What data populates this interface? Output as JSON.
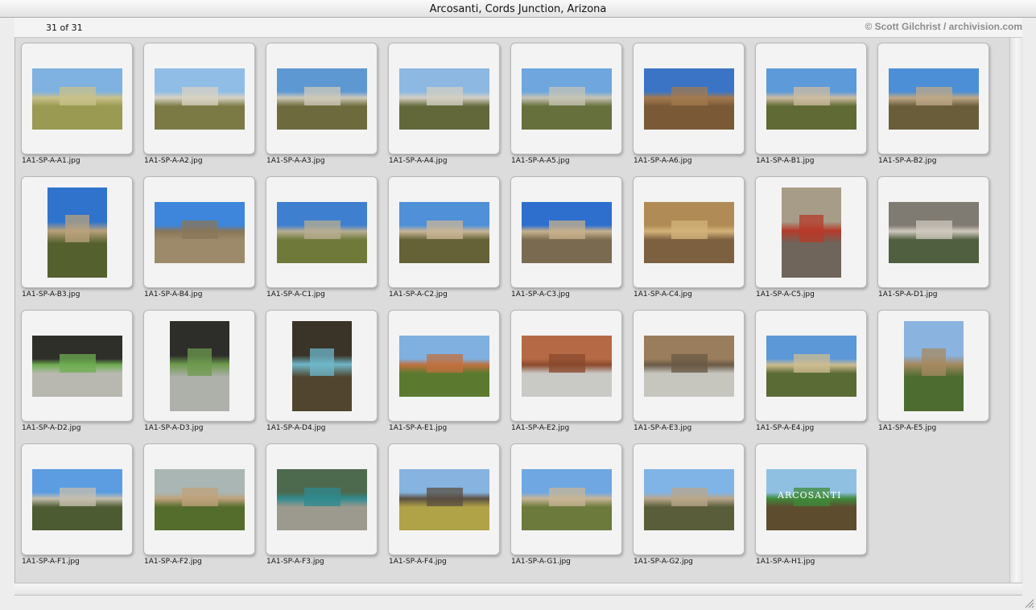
{
  "window": {
    "title": "Arcosanti, Cords Junction, Arizona"
  },
  "info": {
    "count": "31 of 31",
    "credit": "© Scott Gilchrist / archivision.com"
  },
  "items": [
    {
      "filename": "1A1-SP-A-A1.jpg",
      "orient": "landscape",
      "sky": "#7fb2e0",
      "ground": "#9a9a52",
      "accent": "#c9c18a"
    },
    {
      "filename": "1A1-SP-A-A2.jpg",
      "orient": "landscape",
      "sky": "#8fbde6",
      "ground": "#7b7a45",
      "accent": "#d8d2c2"
    },
    {
      "filename": "1A1-SP-A-A3.jpg",
      "orient": "landscape",
      "sky": "#5e98d2",
      "ground": "#6d6b3d",
      "accent": "#cfcab9"
    },
    {
      "filename": "1A1-SP-A-A4.jpg",
      "orient": "landscape",
      "sky": "#8cb8e2",
      "ground": "#62683a",
      "accent": "#d3cfc3"
    },
    {
      "filename": "1A1-SP-A-A5.jpg",
      "orient": "landscape",
      "sky": "#6ea6dd",
      "ground": "#66703c",
      "accent": "#c7c4b5"
    },
    {
      "filename": "1A1-SP-A-A6.jpg",
      "orient": "landscape",
      "sky": "#3b74c4",
      "ground": "#7a5a36",
      "accent": "#a37a4f"
    },
    {
      "filename": "1A1-SP-A-B1.jpg",
      "orient": "landscape",
      "sky": "#5d9ad9",
      "ground": "#5f6a34",
      "accent": "#cdbca0"
    },
    {
      "filename": "1A1-SP-A-B2.jpg",
      "orient": "landscape",
      "sky": "#4c8fd6",
      "ground": "#6a5d3a",
      "accent": "#bfa887"
    },
    {
      "filename": "1A1-SP-A-B3.jpg",
      "orient": "portrait",
      "sky": "#2f73cc",
      "ground": "#55602f",
      "accent": "#b9a17c"
    },
    {
      "filename": "1A1-SP-A-B4.jpg",
      "orient": "landscape",
      "sky": "#3d86db",
      "ground": "#9c8a6a",
      "accent": "#8a7658"
    },
    {
      "filename": "1A1-SP-A-C1.jpg",
      "orient": "landscape",
      "sky": "#3f7fd0",
      "ground": "#6f7a3a",
      "accent": "#b8ad92"
    },
    {
      "filename": "1A1-SP-A-C2.jpg",
      "orient": "landscape",
      "sky": "#4f90d8",
      "ground": "#646236",
      "accent": "#c9b597"
    },
    {
      "filename": "1A1-SP-A-C3.jpg",
      "orient": "landscape",
      "sky": "#2e6fcd",
      "ground": "#7a6b50",
      "accent": "#c7b08c"
    },
    {
      "filename": "1A1-SP-A-C4.jpg",
      "orient": "landscape",
      "sky": "#b08b55",
      "ground": "#7d6040",
      "accent": "#d3b37a"
    },
    {
      "filename": "1A1-SP-A-C5.jpg",
      "orient": "portrait",
      "sky": "#a79c88",
      "ground": "#6f655a",
      "accent": "#b53a2a"
    },
    {
      "filename": "1A1-SP-A-D1.jpg",
      "orient": "landscape",
      "sky": "#7f7a72",
      "ground": "#4f5f3f",
      "accent": "#cfc8bd"
    },
    {
      "filename": "1A1-SP-A-D2.jpg",
      "orient": "landscape",
      "sky": "#2f2f2a",
      "ground": "#b8b8b0",
      "accent": "#6fae52"
    },
    {
      "filename": "1A1-SP-A-D3.jpg",
      "orient": "portrait",
      "sky": "#2d2d2a",
      "ground": "#aeb0aa",
      "accent": "#6d9a4d"
    },
    {
      "filename": "1A1-SP-A-D4.jpg",
      "orient": "portrait",
      "sky": "#3a3328",
      "ground": "#51452f",
      "accent": "#6fb7c9"
    },
    {
      "filename": "1A1-SP-A-E1.jpg",
      "orient": "landscape",
      "sky": "#7fb0e0",
      "ground": "#5b7a2f",
      "accent": "#c0703e"
    },
    {
      "filename": "1A1-SP-A-E2.jpg",
      "orient": "landscape",
      "sky": "#b56a45",
      "ground": "#c9c9c6",
      "accent": "#8a4a2e"
    },
    {
      "filename": "1A1-SP-A-E3.jpg",
      "orient": "landscape",
      "sky": "#9a7d5c",
      "ground": "#c6c6bf",
      "accent": "#6a5a46"
    },
    {
      "filename": "1A1-SP-A-E4.jpg",
      "orient": "landscape",
      "sky": "#5c97d7",
      "ground": "#5a6b35",
      "accent": "#cdbc90"
    },
    {
      "filename": "1A1-SP-A-E5.jpg",
      "orient": "portrait",
      "sky": "#8bb3df",
      "ground": "#4d6c2f",
      "accent": "#a58960"
    },
    {
      "filename": "1A1-SP-A-F1.jpg",
      "orient": "landscape",
      "sky": "#5c9de2",
      "ground": "#4d5b33",
      "accent": "#c5bfae"
    },
    {
      "filename": "1A1-SP-A-F2.jpg",
      "orient": "landscape",
      "sky": "#aab6b3",
      "ground": "#556d2c",
      "accent": "#bfa27c"
    },
    {
      "filename": "1A1-SP-A-F3.jpg",
      "orient": "landscape",
      "sky": "#4d6a4f",
      "ground": "#9c9a8e",
      "accent": "#2f8a8f"
    },
    {
      "filename": "1A1-SP-A-F4.jpg",
      "orient": "landscape",
      "sky": "#86b3df",
      "ground": "#b0a247",
      "accent": "#5a4f42"
    },
    {
      "filename": "1A1-SP-A-G1.jpg",
      "orient": "landscape",
      "sky": "#6ea7e2",
      "ground": "#6c7a3c",
      "accent": "#c8b596"
    },
    {
      "filename": "1A1-SP-A-G2.jpg",
      "orient": "landscape",
      "sky": "#80b4e6",
      "ground": "#5a5d3a",
      "accent": "#b9a78b"
    },
    {
      "filename": "1A1-SP-A-H1.jpg",
      "orient": "landscape",
      "sky": "#8fc0e2",
      "ground": "#5e4c2f",
      "accent": "#3e8a3a",
      "sign": "ARCOSANTI"
    }
  ]
}
